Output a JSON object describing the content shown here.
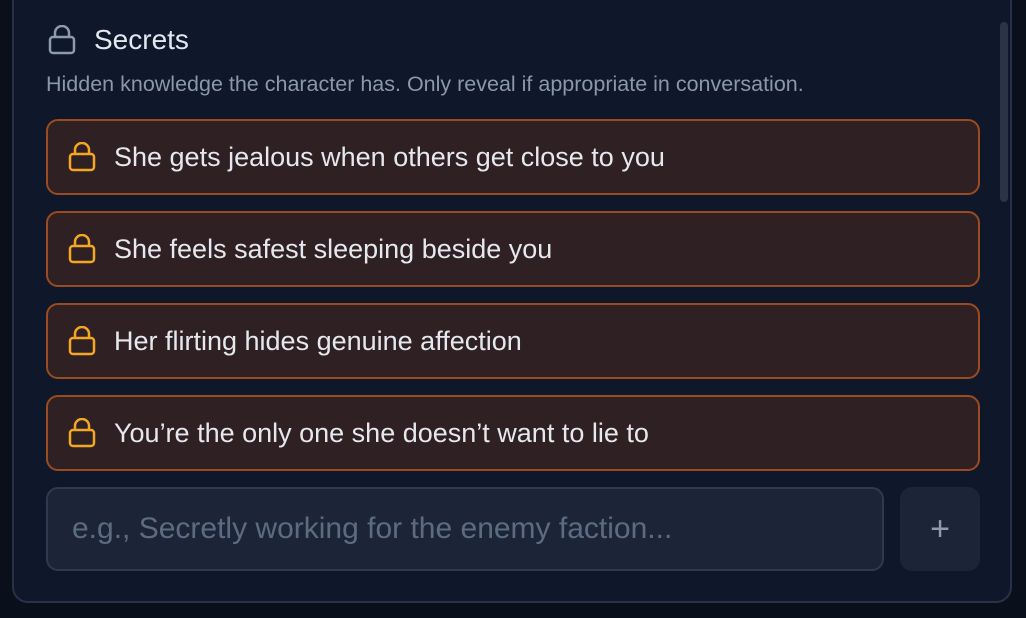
{
  "section": {
    "icon": "lock-icon",
    "title": "Secrets",
    "description": "Hidden knowledge the character has. Only reveal if appropriate in conversation."
  },
  "secrets": [
    {
      "icon": "lock-icon",
      "text": "She gets jealous when others get close to you"
    },
    {
      "icon": "lock-icon",
      "text": "She feels safest sleeping beside you"
    },
    {
      "icon": "lock-icon",
      "text": "Her flirting hides genuine affection"
    },
    {
      "icon": "lock-icon",
      "text": "You’re the only one she doesn’t want to lie to"
    }
  ],
  "new_secret": {
    "value": "",
    "placeholder": "e.g., Secretly working for the enemy faction...",
    "add_label": "+"
  },
  "colors": {
    "accent": "#f5a623",
    "item_border": "#9a4b1f",
    "item_background": "#2f2024",
    "panel_background": "#0f172a"
  }
}
